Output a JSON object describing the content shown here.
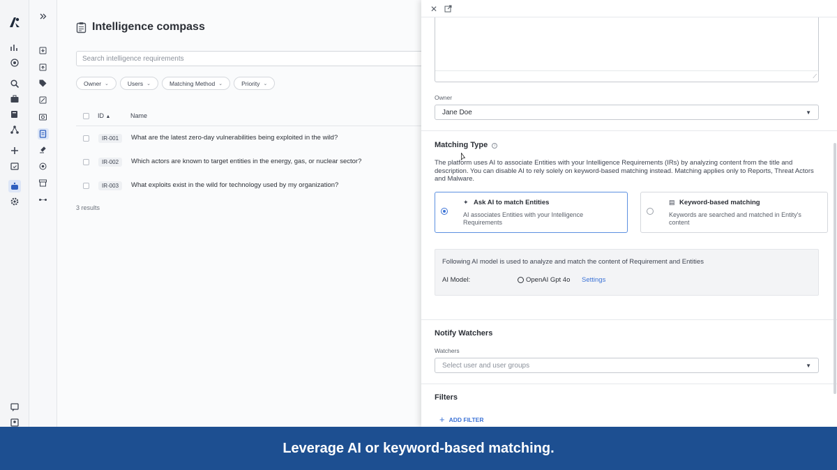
{
  "page": {
    "title": "Intelligence compass",
    "search_placeholder": "Search intelligence requirements",
    "filters": [
      "Owner",
      "Users",
      "Matching Method",
      "Priority"
    ],
    "table": {
      "headers": {
        "id": "ID",
        "name": "Name"
      },
      "rows": [
        {
          "id": "IR-001",
          "name": "What are the latest zero-day vulnerabilities being exploited in the wild?"
        },
        {
          "id": "IR-002",
          "name": "Which actors are known to target entities in the energy, gas, or nuclear sector?"
        },
        {
          "id": "IR-003",
          "name": "What exploits exist in the wild for technology used by my organization?"
        }
      ],
      "results": "3 results"
    }
  },
  "panel": {
    "owner_label": "Owner",
    "owner_value": "Jane Doe",
    "matching_type": {
      "title": "Matching Type",
      "description": "The platform uses AI to associate Entities with your Intelligence Requirements (IRs) by analyzing content from the title and description. You can disable AI to rely solely on keyword-based matching instead. Matching applies only to Reports, Threat Actors and Malware.",
      "options": {
        "ai": {
          "title": "Ask AI to match Entities",
          "desc": "AI associates Entities with your Intelligence Requirements",
          "selected": true
        },
        "keyword": {
          "title": "Keyword-based matching",
          "desc": "Keywords are searched and matched in Entity's content",
          "selected": false
        }
      },
      "model_note": "Following AI model is used to analyze and match the content of Requirement and Entities",
      "model_label": "AI Model:",
      "model_value": "OpenAI Gpt 4o",
      "settings_link": "Settings"
    },
    "notify": {
      "title": "Notify Watchers",
      "watchers_label": "Watchers",
      "watchers_placeholder": "Select user and user groups"
    },
    "filters": {
      "title": "Filters",
      "add_filter": "ADD FILTER"
    }
  },
  "banner": {
    "caption": "Leverage AI or keyword-based matching."
  },
  "colors": {
    "accent": "#3c73d6",
    "banner": "#1d4f91"
  }
}
